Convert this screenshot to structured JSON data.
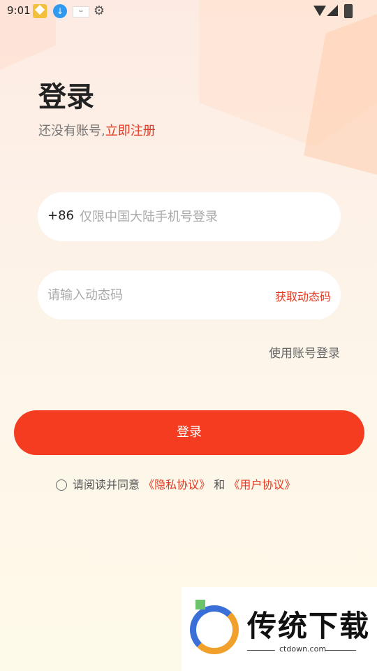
{
  "status_bar": {
    "time": "9:01"
  },
  "header": {
    "title": "登录",
    "subtitle_prefix": "还没有账号,",
    "register_link": "立即注册"
  },
  "phone_field": {
    "country_code": "+86",
    "placeholder": "仅限中国大陆手机号登录"
  },
  "code_field": {
    "placeholder": "请输入动态码",
    "get_code_label": "获取动态码"
  },
  "account_login_label": "使用账号登录",
  "login_button_label": "登录",
  "agreement": {
    "prefix": "请阅读并同意",
    "privacy_link": "《隐私协议》",
    "and": "和",
    "user_link": "《用户协议》"
  },
  "watermark": {
    "brand": "传统下载",
    "url": "ctdown.com"
  },
  "colors": {
    "accent": "#f43c20",
    "link": "#e23a22"
  }
}
